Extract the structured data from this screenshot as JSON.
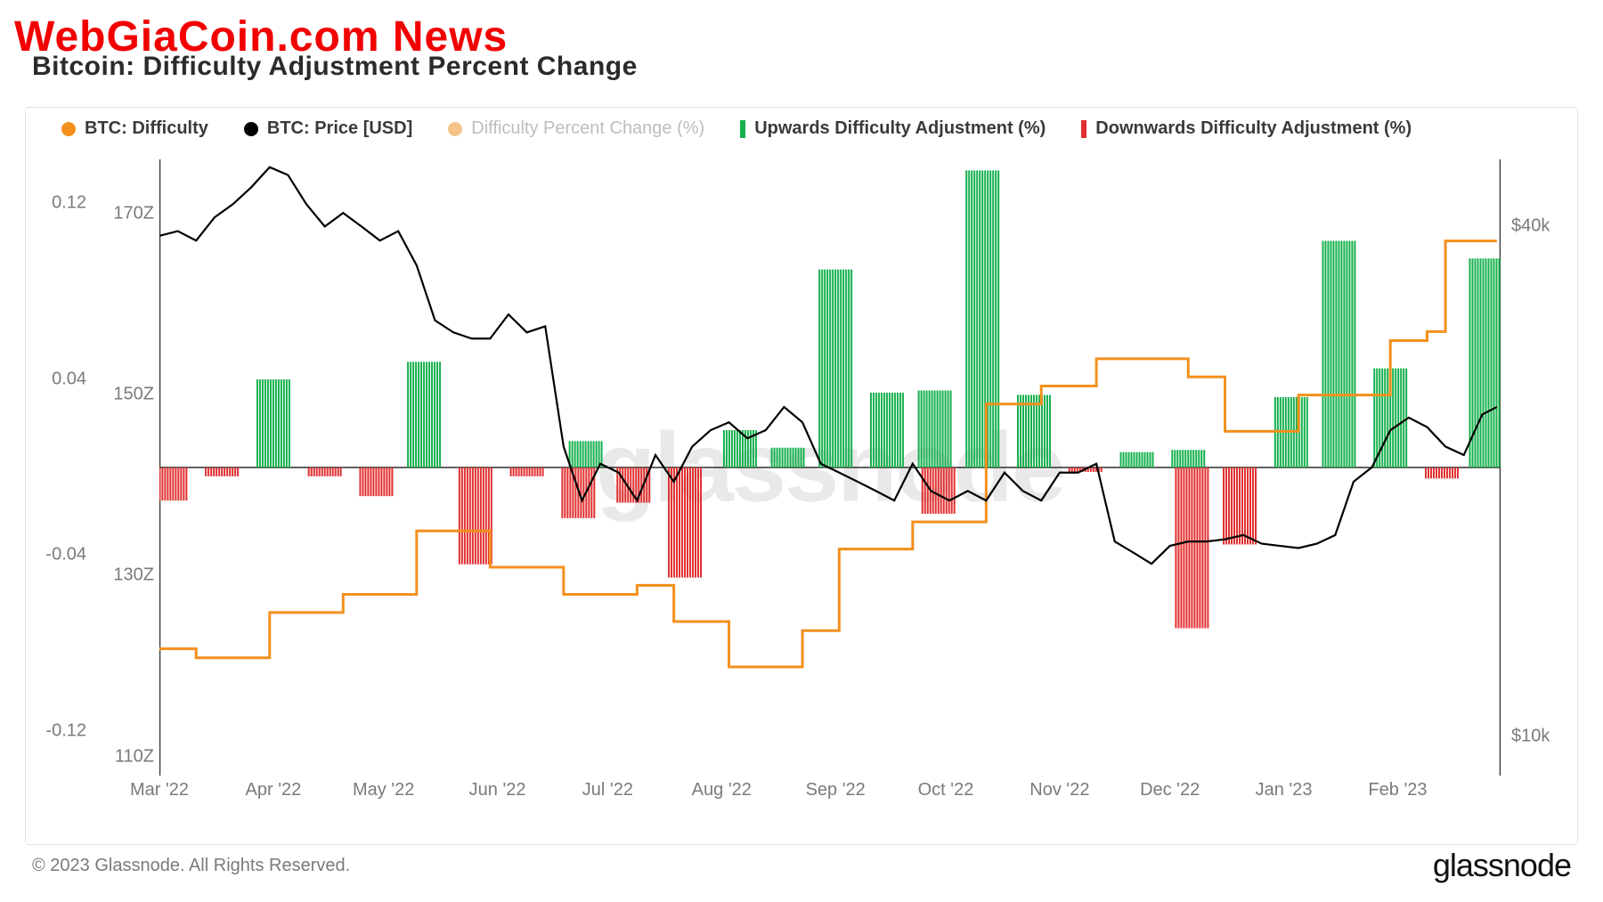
{
  "overlay_brand": "WebGiaCoin.com News",
  "title": "Bitcoin: Difficulty Adjustment Percent Change",
  "legend": {
    "difficulty": "BTC: Difficulty",
    "price": "BTC: Price [USD]",
    "pct": "Difficulty Percent Change (%)",
    "up": "Upwards Difficulty Adjustment (%)",
    "down": "Downwards Difficulty Adjustment (%)"
  },
  "colors": {
    "orange": "#f3901d",
    "black": "#000000",
    "green": "#15b04c",
    "red": "#e22f2f"
  },
  "axes": {
    "left_pct_ticks": [
      "0.12",
      "0.04",
      "-0.04",
      "-0.12"
    ],
    "left_pct_positions": [
      0.12,
      0.04,
      -0.04,
      -0.12
    ],
    "left_z_ticks": [
      "170Z",
      "150Z",
      "130Z",
      "110Z"
    ],
    "left_z_positions": [
      170,
      150,
      130,
      110
    ],
    "right_usd_ticks": [
      "$40k",
      "$10k"
    ],
    "right_usd_positions": [
      40000,
      10000
    ],
    "x_ticks": [
      "Mar '22",
      "Apr '22",
      "May '22",
      "Jun '22",
      "Jul '22",
      "Aug '22",
      "Sep '22",
      "Oct '22",
      "Nov '22",
      "Dec '22",
      "Jan '23",
      "Feb '23"
    ]
  },
  "chart_data": {
    "type": "mixed",
    "x_range_months": [
      "2022-03",
      "2023-03"
    ],
    "pct_range": [
      -0.14,
      0.14
    ],
    "z_range": [
      108,
      176
    ],
    "usd_log_range": [
      9000,
      48000
    ],
    "title": "Bitcoin: Difficulty Adjustment Percent Change",
    "x": [
      "2022-03-01",
      "2022-03-06",
      "2022-03-11",
      "2022-03-16",
      "2022-03-21",
      "2022-03-26",
      "2022-03-31",
      "2022-04-05",
      "2022-04-10",
      "2022-04-15",
      "2022-04-20",
      "2022-04-25",
      "2022-04-30",
      "2022-05-05",
      "2022-05-10",
      "2022-05-15",
      "2022-05-20",
      "2022-05-25",
      "2022-05-30",
      "2022-06-04",
      "2022-06-09",
      "2022-06-14",
      "2022-06-19",
      "2022-06-24",
      "2022-06-29",
      "2022-07-04",
      "2022-07-09",
      "2022-07-14",
      "2022-07-19",
      "2022-07-24",
      "2022-07-29",
      "2022-08-03",
      "2022-08-08",
      "2022-08-13",
      "2022-08-18",
      "2022-08-23",
      "2022-08-28",
      "2022-09-02",
      "2022-09-07",
      "2022-09-12",
      "2022-09-17",
      "2022-09-22",
      "2022-09-27",
      "2022-10-02",
      "2022-10-07",
      "2022-10-12",
      "2022-10-17",
      "2022-10-22",
      "2022-10-27",
      "2022-11-01",
      "2022-11-06",
      "2022-11-11",
      "2022-11-16",
      "2022-11-21",
      "2022-11-26",
      "2022-12-01",
      "2022-12-06",
      "2022-12-11",
      "2022-12-16",
      "2022-12-21",
      "2022-12-26",
      "2022-12-31",
      "2023-01-05",
      "2023-01-10",
      "2023-01-15",
      "2023-01-20",
      "2023-01-25",
      "2023-01-30",
      "2023-02-04",
      "2023-02-09",
      "2023-02-14",
      "2023-02-19",
      "2023-02-24",
      "2023-02-28"
    ],
    "series": [
      {
        "name": "BTC: Price [USD]",
        "kind": "line",
        "color": "#000000",
        "values": [
          39000,
          39500,
          38500,
          41000,
          42500,
          44500,
          47000,
          46000,
          42500,
          40000,
          41500,
          40000,
          38500,
          39500,
          36000,
          31000,
          30000,
          29500,
          29500,
          31500,
          30000,
          30500,
          22000,
          19000,
          21000,
          20500,
          19000,
          21500,
          20000,
          22000,
          23000,
          23500,
          22500,
          23000,
          24500,
          23500,
          21000,
          20500,
          20000,
          19500,
          19000,
          21000,
          19500,
          19000,
          19500,
          19000,
          20500,
          19500,
          19000,
          20500,
          20500,
          21000,
          17000,
          16500,
          16000,
          16800,
          17000,
          17000,
          17100,
          17300,
          16900,
          16800,
          16700,
          16900,
          17300,
          20000,
          20800,
          23000,
          23800,
          23200,
          22000,
          21500,
          24000,
          24500
        ]
      },
      {
        "name": "BTC: Difficulty",
        "kind": "step",
        "color": "#f3901d",
        "values": [
          122,
          122,
          121,
          121,
          121,
          121,
          126,
          126,
          126,
          126,
          128,
          128,
          128,
          128,
          135,
          135,
          135,
          135,
          131,
          131,
          131,
          131,
          128,
          128,
          128,
          128,
          129,
          129,
          125,
          125,
          125,
          120,
          120,
          120,
          120,
          124,
          124,
          133,
          133,
          133,
          133,
          136,
          136,
          136,
          136,
          149,
          149,
          149,
          151,
          151,
          151,
          154,
          154,
          154,
          154,
          154,
          152,
          152,
          146,
          146,
          146,
          146,
          150,
          150,
          150,
          150,
          150,
          156,
          156,
          157,
          167,
          167,
          167,
          167
        ]
      },
      {
        "name": "Upwards Difficulty Adjustment (%)",
        "kind": "bar-up",
        "color": "#15b04c",
        "bars": [
          {
            "x": "2022-04-01",
            "val": 0.04
          },
          {
            "x": "2022-05-12",
            "val": 0.048
          },
          {
            "x": "2022-06-25",
            "val": 0.012
          },
          {
            "x": "2022-08-06",
            "val": 0.017
          },
          {
            "x": "2022-08-19",
            "val": 0.009
          },
          {
            "x": "2022-09-01",
            "val": 0.09
          },
          {
            "x": "2022-09-15",
            "val": 0.034
          },
          {
            "x": "2022-09-28",
            "val": 0.035
          },
          {
            "x": "2022-10-11",
            "val": 0.135
          },
          {
            "x": "2022-10-25",
            "val": 0.033
          },
          {
            "x": "2022-11-22",
            "val": 0.007
          },
          {
            "x": "2022-12-06",
            "val": 0.008
          },
          {
            "x": "2023-01-03",
            "val": 0.032
          },
          {
            "x": "2023-01-16",
            "val": 0.103
          },
          {
            "x": "2023-01-30",
            "val": 0.045
          },
          {
            "x": "2023-02-25",
            "val": 0.095
          }
        ]
      },
      {
        "name": "Downwards Difficulty Adjustment (%)",
        "kind": "bar-down",
        "color": "#e22f2f",
        "bars": [
          {
            "x": "2022-03-04",
            "val": -0.015
          },
          {
            "x": "2022-03-18",
            "val": -0.004
          },
          {
            "x": "2022-04-15",
            "val": -0.004
          },
          {
            "x": "2022-04-29",
            "val": -0.013
          },
          {
            "x": "2022-05-26",
            "val": -0.044
          },
          {
            "x": "2022-06-09",
            "val": -0.004
          },
          {
            "x": "2022-06-23",
            "val": -0.023
          },
          {
            "x": "2022-07-08",
            "val": -0.016
          },
          {
            "x": "2022-07-22",
            "val": -0.05
          },
          {
            "x": "2022-09-29",
            "val": -0.021
          },
          {
            "x": "2022-11-08",
            "val": -0.002
          },
          {
            "x": "2022-12-07",
            "val": -0.073
          },
          {
            "x": "2022-12-20",
            "val": -0.035
          },
          {
            "x": "2023-02-13",
            "val": -0.005
          }
        ]
      }
    ]
  },
  "footer": {
    "copyright": "© 2023 Glassnode. All Rights Reserved.",
    "brand": "glassnode"
  },
  "watermark": "glassnode"
}
